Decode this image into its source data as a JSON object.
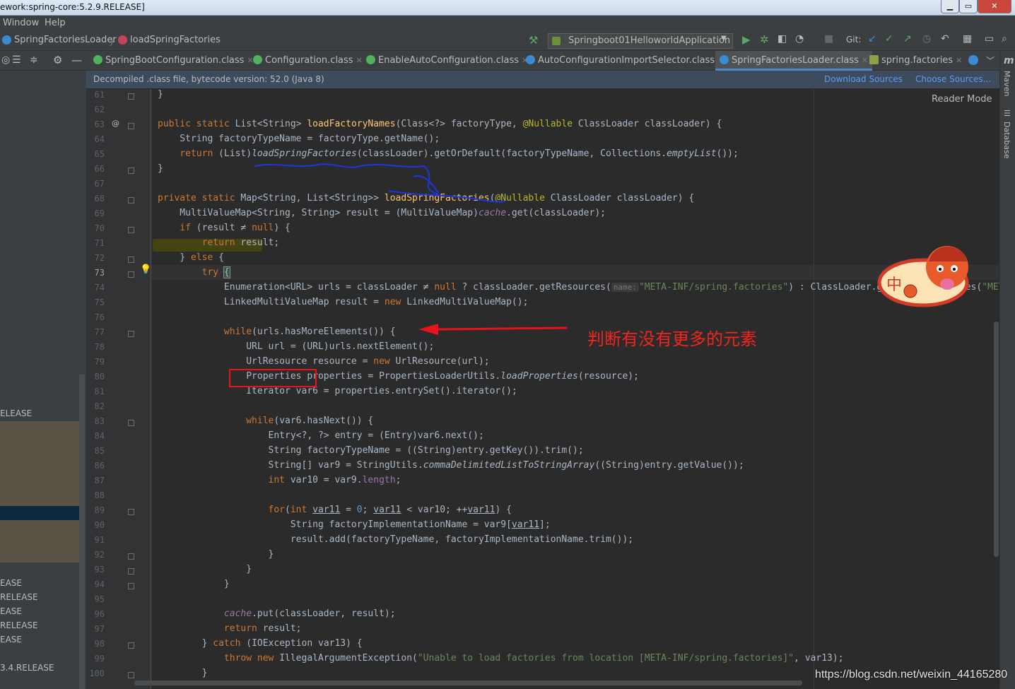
{
  "window": {
    "title": "ework:spring-core:5.2.9.RELEASE]",
    "min_label": "▁",
    "max_label": "▭",
    "close_label": "✕"
  },
  "menu": {
    "window": "Window",
    "help": "Help"
  },
  "breadcrumb": {
    "class_name": "SpringFactoriesLoader",
    "method_name": "loadSpringFactories"
  },
  "run_config": {
    "label": "Springboot01HelloworldApplication",
    "git_label": "Git:"
  },
  "tabs": [
    {
      "label": "SpringBootConfiguration.class",
      "color": "#4eb25e"
    },
    {
      "label": "Configuration.class",
      "color": "#4eb25e"
    },
    {
      "label": "EnableAutoConfiguration.class",
      "color": "#4eb25e"
    },
    {
      "label": "AutoConfigurationImportSelector.class",
      "color": "#3b8bd4"
    },
    {
      "label": "SpringFactoriesLoader.class",
      "color": "#3b8bd4"
    },
    {
      "label": "spring.factories",
      "color": "#8aa34b"
    }
  ],
  "infobar": {
    "message": "Decompiled .class file, bytecode version: 52.0 (Java 8)",
    "download_sources": "Download Sources",
    "choose_sources": "Choose Sources..."
  },
  "reader_mode": "Reader Mode",
  "right_tools": {
    "maven": "Maven",
    "database": "Database",
    "m_icon": "m"
  },
  "left_panel": {
    "items": [
      "ELEASE",
      "EASE",
      "RELEASE",
      "EASE",
      "RELEASE",
      "EASE",
      "3.4.RELEASE"
    ]
  },
  "line_numbers": [
    "61",
    "62",
    "63",
    "64",
    "65",
    "66",
    "67",
    "68",
    "69",
    "70",
    "71",
    "72",
    "73",
    "74",
    "75",
    "76",
    "77",
    "78",
    "79",
    "80",
    "81",
    "82",
    "83",
    "84",
    "85",
    "86",
    "87",
    "88",
    "89",
    "90",
    "91",
    "92",
    "93",
    "94",
    "95",
    "96",
    "97",
    "98",
    "99",
    "100"
  ],
  "code": {
    "l61": "}",
    "l63": [
      "public static ",
      "List<String> ",
      "loadFactoryNames",
      "(Class<?> factoryType, ",
      "@Nullable",
      " ClassLoader classLoader) {"
    ],
    "l64": "    String factoryTypeName = factoryType.getName();",
    "l65": [
      "    return ",
      "(List)",
      "loadSpringFactories",
      "(classLoader).getOrDefault(factoryTypeName, Collections.",
      "emptyList",
      "());"
    ],
    "l66": "}",
    "l68": [
      "private static ",
      "Map<String, List<String>> ",
      "loadSpringFactories",
      "(",
      "@Nullable",
      " ClassLoader classLoader) {"
    ],
    "l69": [
      "    MultiValueMap<String, String> result = (MultiValueMap)",
      "cache",
      ".get(classLoader);"
    ],
    "l70": [
      "    if ",
      "(result ≠ ",
      "null",
      ") {"
    ],
    "l71": [
      "        return ",
      "result;"
    ],
    "l72": [
      "    } ",
      "else",
      " {"
    ],
    "l73": [
      "        try ",
      "{"
    ],
    "l74": [
      "            Enumeration<URL> urls = classLoader ≠ ",
      "null",
      " ? classLoader.getResources(",
      "name:",
      "\"META-INF/spring.factories\"",
      ") : ClassLoader.getSystemResources(",
      "\"META-INF/spring.factories\"",
      ");"
    ],
    "l75": [
      "            LinkedMultiValueMap result = ",
      "new",
      " LinkedMultiValueMap();"
    ],
    "l77": [
      "            while",
      "(urls.hasMoreElements()) {"
    ],
    "l78": "                URL url = (URL)urls.nextElement();",
    "l79": [
      "                UrlResource resource = ",
      "new",
      " UrlResource(url);"
    ],
    "l80": [
      "                Properties properties = PropertiesLoaderUtils.",
      "loadProperties",
      "(resource);"
    ],
    "l81": "                Iterator var6 = properties.entrySet().iterator();",
    "l83": [
      "                while",
      "(var6.hasNext()) {"
    ],
    "l84": "                    Entry<?, ?> entry = (Entry)var6.next();",
    "l85": "                    String factoryTypeName = ((String)entry.getKey()).trim();",
    "l86": [
      "                    String[] var9 = StringUtils.",
      "commaDelimitedListToStringArray",
      "((String)entry.getValue());"
    ],
    "l87": [
      "                    int",
      " var10 = var9.",
      "length",
      ";"
    ],
    "l89": [
      "                    for",
      "(",
      "int ",
      "var11",
      " = ",
      "0",
      "; ",
      "var11",
      " < var10; ++",
      "var11",
      ") {"
    ],
    "l90": [
      "                        String factoryImplementationName = var9[",
      "var11",
      "];"
    ],
    "l91": "                        result.add(factoryTypeName, factoryImplementationName.trim());",
    "l92": "                    }",
    "l93": "                }",
    "l94": "            }",
    "l96": [
      "            ",
      "cache",
      ".put(classLoader, result);"
    ],
    "l97": [
      "            return ",
      "result;"
    ],
    "l98": [
      "        } ",
      "catch",
      " (IOException var13) {"
    ],
    "l99": [
      "            throw new ",
      "IllegalArgumentException(",
      "\"Unable to load factories from location [META-INF/spring.factories]\"",
      ", var13);"
    ],
    "l100": "        }"
  },
  "annotation": {
    "text": "判断有没有更多的元素",
    "color": "#f0261e"
  },
  "sticker": {
    "glyph": "中"
  },
  "watermark": "https://blog.csdn.net/weixin_44165280",
  "colors": {
    "keyword": "#cc7832",
    "function": "#ffc66d",
    "annotation": "#bbb529",
    "string": "#6a8759",
    "field": "#9876aa",
    "number": "#6897bb"
  }
}
